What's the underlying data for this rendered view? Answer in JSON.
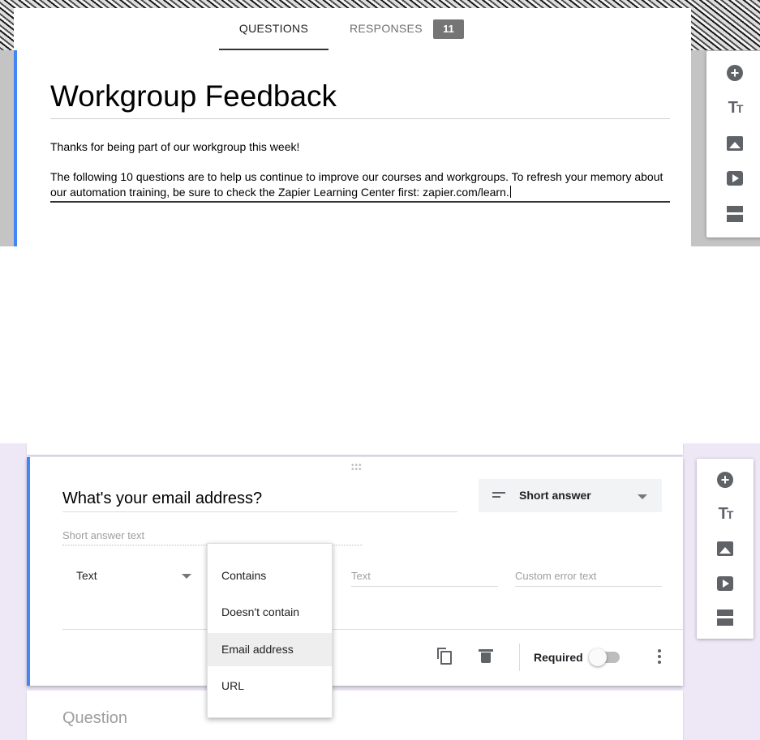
{
  "tabs": {
    "questions": "QUESTIONS",
    "responses": "RESPONSES",
    "responses_count": "11"
  },
  "form": {
    "title": "Workgroup Feedback",
    "description_line1": "Thanks for being part of our workgroup this week!",
    "description_line2": "The following 10 questions are to help us continue to improve our courses and workgroups. To refresh your memory about our automation training, be sure to check the Zapier Learning Center first: zapier.com/learn."
  },
  "toolbar": {
    "items": [
      "add-question-icon",
      "add-title-icon",
      "add-image-icon",
      "add-video-icon",
      "add-section-icon"
    ]
  },
  "question": {
    "title": "What's your email address?",
    "type": "Short answer",
    "answer_placeholder": "Short answer text",
    "validation_type": "Text",
    "validation_value_placeholder": "Text",
    "error_text_placeholder": "Custom error text",
    "required_label": "Required",
    "required": false
  },
  "condition_menu": {
    "options": [
      "Contains",
      "Doesn't contain",
      "Email address",
      "URL"
    ],
    "highlighted": "Email address"
  },
  "next_question": {
    "placeholder": "Question"
  },
  "colors": {
    "accent": "#4285f4",
    "panel_background": "#ede7f6",
    "badge": "#757575"
  }
}
